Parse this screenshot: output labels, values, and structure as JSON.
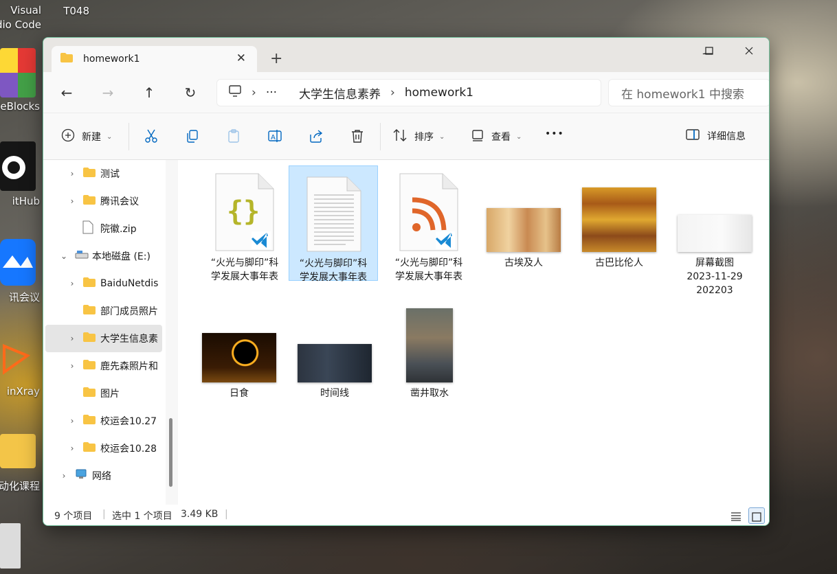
{
  "desktop": {
    "icons": [
      {
        "label_a": "Visual",
        "label_b": "dio Code"
      },
      {
        "label": "T048"
      },
      {
        "label": "leBlocks"
      },
      {
        "label": "itHub"
      },
      {
        "label": "讯会议"
      },
      {
        "label": "inXray"
      },
      {
        "label": "动化课程"
      }
    ]
  },
  "window": {
    "tab_title": "homework1",
    "close_tab": "✕",
    "new_tab": "+",
    "controls": {
      "minimize": "—",
      "maximize": "☐",
      "close": "✕"
    },
    "nav": {
      "back": "←",
      "forward": "→",
      "up": "↑",
      "refresh": "↻"
    },
    "breadcrumb": {
      "more": "···",
      "items": [
        "大学生信息素养",
        "homework1"
      ],
      "sep": "›"
    },
    "search_placeholder": "在 homework1 中搜索",
    "toolbar": {
      "new_label": "新建",
      "sort_label": "排序",
      "view_label": "查看",
      "more": "•••",
      "details_label": "详细信息"
    },
    "sidebar": {
      "items": [
        {
          "label": "测试",
          "chevron": "›",
          "type": "folder"
        },
        {
          "label": "腾讯会议",
          "chevron": "›",
          "type": "folder"
        },
        {
          "label": "院徽.zip",
          "chevron": "",
          "type": "file"
        },
        {
          "label": "本地磁盘 (E:)",
          "chevron": "⌄",
          "type": "drive"
        },
        {
          "label": "BaiduNetdis",
          "chevron": "›",
          "type": "folder"
        },
        {
          "label": "部门成员照片",
          "chevron": "",
          "type": "folder"
        },
        {
          "label": "大学生信息素",
          "chevron": "›",
          "type": "folder",
          "selected": true
        },
        {
          "label": "鹿先森照片和",
          "chevron": "›",
          "type": "folder"
        },
        {
          "label": "图片",
          "chevron": "",
          "type": "folder"
        },
        {
          "label": "校运会10.27",
          "chevron": "›",
          "type": "folder"
        },
        {
          "label": "校运会10.28",
          "chevron": "›",
          "type": "folder"
        },
        {
          "label": "网络",
          "chevron": "›",
          "type": "network"
        }
      ]
    },
    "files": [
      {
        "line1": "“火光与脚印”科",
        "line2": "学发展大事年表",
        "kind": "json-vscode"
      },
      {
        "line1": "“火光与脚印”科",
        "line2": "学发展大事年表",
        "kind": "text",
        "selected": true
      },
      {
        "line1": "“火光与脚印”科",
        "line2": "学发展大事年表",
        "kind": "rss-vscode"
      },
      {
        "line1": "古埃及人",
        "kind": "image"
      },
      {
        "line1": "古巴比伦人",
        "kind": "image"
      },
      {
        "line1": "屏幕截图",
        "line2": "2023-11-29",
        "line3": "202203",
        "kind": "image"
      },
      {
        "line1": "日食",
        "kind": "image"
      },
      {
        "line1": "时间线",
        "kind": "image"
      },
      {
        "line1": "凿井取水",
        "kind": "image"
      }
    ],
    "status": {
      "count": "9 个项目",
      "selection": "选中 1 个项目",
      "size": "3.49 KB"
    },
    "colors": {
      "accent": "#0067c0",
      "folder": "#f8c444",
      "selection": "#cce8ff"
    }
  }
}
